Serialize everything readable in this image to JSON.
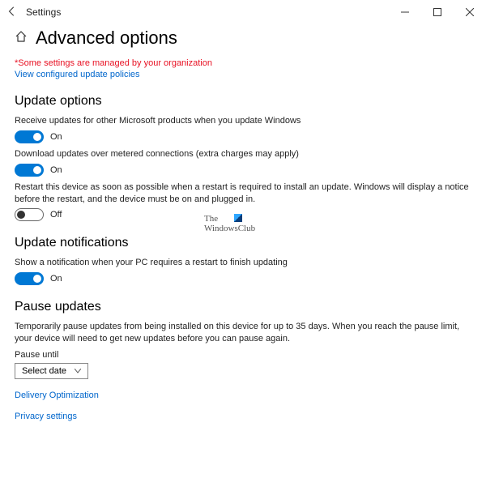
{
  "window": {
    "app_title": "Settings"
  },
  "page": {
    "title": "Advanced options",
    "policy_warning": "*Some settings are managed by your organization",
    "policy_link": "View configured update policies"
  },
  "sections": {
    "update_options": {
      "title": "Update options",
      "receive_updates": {
        "label": "Receive updates for other Microsoft products when you update Windows",
        "state": "On",
        "on": true
      },
      "metered": {
        "label": "Download updates over metered connections (extra charges may apply)",
        "state": "On",
        "on": true
      },
      "restart": {
        "label": "Restart this device as soon as possible when a restart is required to install an update. Windows will display a notice before the restart, and the device must be on and plugged in.",
        "state": "Off",
        "on": false
      }
    },
    "notifications": {
      "title": "Update notifications",
      "show": {
        "label": "Show a notification when your PC requires a restart to finish updating",
        "state": "On",
        "on": true
      }
    },
    "pause": {
      "title": "Pause updates",
      "desc": "Temporarily pause updates from being installed on this device for up to 35 days. When you reach the pause limit, your device will need to get new updates before you can pause again.",
      "until_label": "Pause until",
      "select_placeholder": "Select date"
    }
  },
  "links": {
    "delivery": "Delivery Optimization",
    "privacy": "Privacy settings"
  },
  "watermark": {
    "line1": "The",
    "line2": "WindowsClub"
  }
}
